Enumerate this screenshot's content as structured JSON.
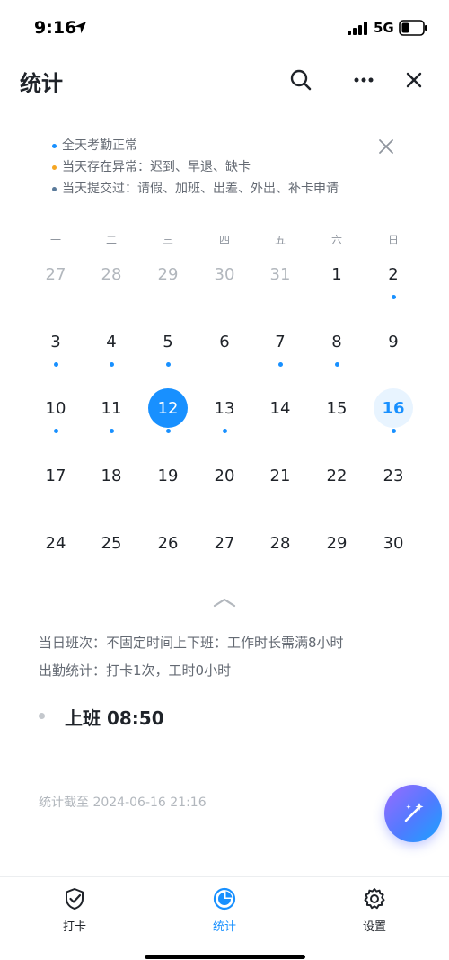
{
  "status_bar": {
    "time": "9:16",
    "network": "5G"
  },
  "nav": {
    "title": "统计"
  },
  "legend": [
    {
      "text": "全天考勤正常",
      "color": "#1890ff"
    },
    {
      "text": "当天存在异常：迟到、早退、缺卡",
      "color": "#f5a623"
    },
    {
      "text": "当天提交过：请假、加班、出差、外出、补卡申请",
      "color": "#5a7a9a"
    }
  ],
  "calendar": {
    "weekdays": [
      "一",
      "二",
      "三",
      "四",
      "五",
      "六",
      "日"
    ],
    "weeks": [
      [
        {
          "day": "27",
          "muted": true
        },
        {
          "day": "28",
          "muted": true
        },
        {
          "day": "29",
          "muted": true
        },
        {
          "day": "30",
          "muted": true
        },
        {
          "day": "31",
          "muted": true
        },
        {
          "day": "1"
        },
        {
          "day": "2",
          "dot": true
        }
      ],
      [
        {
          "day": "3",
          "dot": true
        },
        {
          "day": "4",
          "dot": true
        },
        {
          "day": "5",
          "dot": true
        },
        {
          "day": "6"
        },
        {
          "day": "7",
          "dot": true
        },
        {
          "day": "8",
          "dot": true
        },
        {
          "day": "9"
        }
      ],
      [
        {
          "day": "10",
          "dot": true
        },
        {
          "day": "11",
          "dot": true
        },
        {
          "day": "12",
          "dot": true,
          "selected": true
        },
        {
          "day": "13",
          "dot": true
        },
        {
          "day": "14"
        },
        {
          "day": "15"
        },
        {
          "day": "16",
          "dot": true,
          "today": true
        }
      ],
      [
        {
          "day": "17"
        },
        {
          "day": "18"
        },
        {
          "day": "19"
        },
        {
          "day": "20"
        },
        {
          "day": "21"
        },
        {
          "day": "22"
        },
        {
          "day": "23"
        }
      ],
      [
        {
          "day": "24"
        },
        {
          "day": "25"
        },
        {
          "day": "26"
        },
        {
          "day": "27"
        },
        {
          "day": "28"
        },
        {
          "day": "29"
        },
        {
          "day": "30"
        }
      ]
    ]
  },
  "info": {
    "shift": "当日班次：不固定时间上下班：工作时长需满8小时",
    "attendance": "出勤统计：打卡1次，工时0小时",
    "punch": "上班 08:50",
    "stat_until": "统计截至 2024-06-16 21:16"
  },
  "tabs": [
    {
      "label": "打卡",
      "icon": "check-badge-icon",
      "active": false
    },
    {
      "label": "统计",
      "icon": "pie-chart-icon",
      "active": true
    },
    {
      "label": "设置",
      "icon": "gear-icon",
      "active": false
    }
  ],
  "colors": {
    "accent": "#1890ff",
    "warning": "#f5a623",
    "muted_text": "#646a73"
  }
}
